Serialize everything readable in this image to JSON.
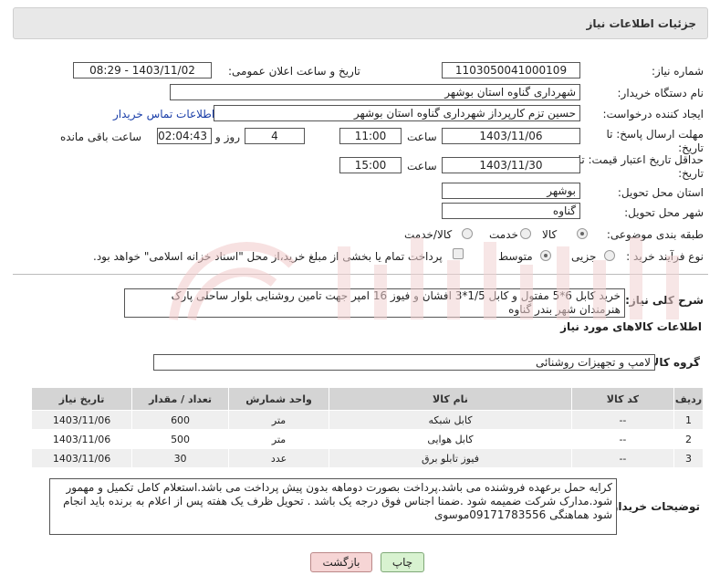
{
  "header": {
    "title": "جزئیات اطلاعات نیاز"
  },
  "form": {
    "need_number_label": "شماره نیاز:",
    "need_number": "1103050041000109",
    "announce_label": "تاریخ و ساعت اعلان عمومی:",
    "announce_value": "1403/11/02 - 08:29",
    "buyer_org_label": "نام دستگاه خریدار:",
    "buyer_org": "شهرداری گناوه استان بوشهر",
    "requester_label": "ایجاد کننده درخواست:",
    "requester": "حسین تزم کارپرداز شهرداری گناوه استان بوشهر",
    "contact_link": "اطلاعات تماس خریدار",
    "deadline_label": "مهلت ارسال پاسخ: تا تاریخ:",
    "deadline_date": "1403/11/06",
    "time_label": "ساعت",
    "deadline_time": "11:00",
    "days_value": "4",
    "days_label": "روز و",
    "remain_value": "02:04:43",
    "remain_label": "ساعت باقی مانده",
    "validity_label": "حداقل تاریخ اعتبار قیمت: تا تاریخ:",
    "validity_date": "1403/11/30",
    "validity_time": "15:00",
    "province_label": "استان محل تحویل:",
    "province": "بوشهر",
    "city_label": "شهر محل تحویل:",
    "city": "گناوه",
    "category_label": "طبقه بندی موضوعی:",
    "cat_opt1": "کالا",
    "cat_opt2": "خدمت",
    "cat_opt3": "کالا/خدمت",
    "process_label": "نوع فرآیند خرید :",
    "proc_opt1": "جزیی",
    "proc_opt2": "متوسط",
    "payment_text": "پرداخت تمام یا بخشی از مبلغ خرید،از محل \"اسناد خزانه اسلامی\" خواهد بود."
  },
  "summary": {
    "label": "شرح کلی نیاز:",
    "text": "خرید کابل 6*5 مفتول و کابل 1/5*3 افشان و فیوز 16 امپر جهت تامین روشنایی بلوار ساحلی پارک هنرمندان شهر بندر گناوه"
  },
  "goods": {
    "section_title": "اطلاعات کالاهای مورد نیاز",
    "group_label": "گروه کالا:",
    "group_value": "لامپ و تجهیزات روشنائی",
    "columns": [
      "ردیف",
      "کد کالا",
      "نام کالا",
      "واحد شمارش",
      "تعداد / مقدار",
      "تاریخ نیاز"
    ],
    "rows": [
      [
        "1",
        "--",
        "کابل شبکه",
        "متر",
        "600",
        "1403/11/06"
      ],
      [
        "2",
        "--",
        "کابل هوایی",
        "متر",
        "500",
        "1403/11/06"
      ],
      [
        "3",
        "--",
        "فیوز تابلو برق",
        "عدد",
        "30",
        "1403/11/06"
      ]
    ]
  },
  "notes": {
    "label": "توضیحات خریدار:",
    "text": "کرایه حمل برعهده فروشنده می باشد.پرداخت بصورت دوماهه بدون پیش پرداخت می باشد.استعلام کامل تکمیل و مهمور شود.مدارک شرکت ضمیمه شود .ضمنا اجناس فوق درجه یک باشد . تحویل ظرف یک هفته پس از اعلام به برنده باید انجام شود هماهنگی 09171783556موسوی"
  },
  "buttons": {
    "print": "چاپ",
    "back": "بازگشت"
  },
  "colors": {
    "link": "#1a3ea8",
    "print_btn": "#d8f2d0",
    "back_btn": "#f6d5d5"
  }
}
